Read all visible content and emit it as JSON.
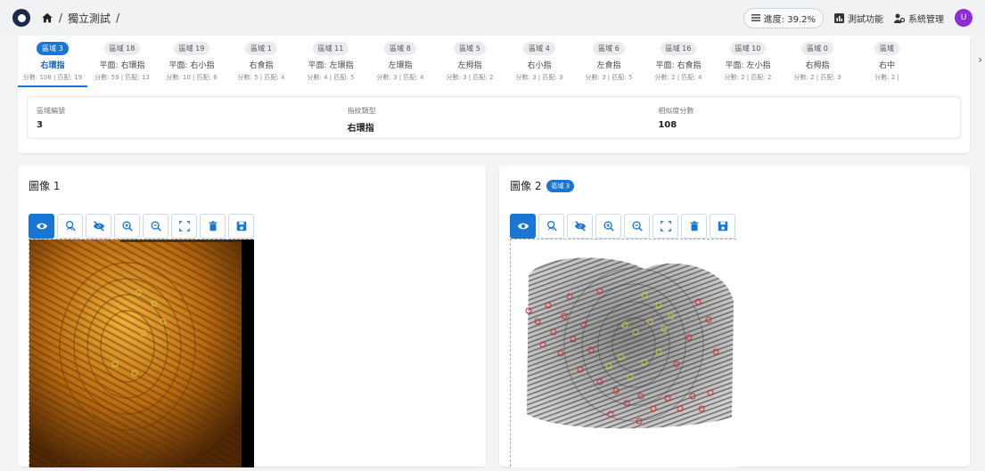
{
  "breadcrumb": {
    "sep1": "/",
    "page": "獨立測試",
    "sep2": "/"
  },
  "header": {
    "progress_label": "進度: 39.2%",
    "test_functions": "測試功能",
    "system_admin": "系統管理",
    "avatar_initial": "U"
  },
  "regions": [
    {
      "chip": "區域 3",
      "name": "右環指",
      "score": "分數: 108 | 匹配: 19",
      "active": true
    },
    {
      "chip": "區域 18",
      "name": "平面: 右環指",
      "score": "分數: 59 | 匹配: 13"
    },
    {
      "chip": "區域 19",
      "name": "平面: 右小指",
      "score": "分數: 10 | 匹配: 6"
    },
    {
      "chip": "區域 1",
      "name": "右食指",
      "score": "分數: 5 | 匹配: 4"
    },
    {
      "chip": "區域 11",
      "name": "平面: 左環指",
      "score": "分數: 4 | 匹配: 5"
    },
    {
      "chip": "區域 8",
      "name": "左環指",
      "score": "分數: 3 | 匹配: 4"
    },
    {
      "chip": "區域 5",
      "name": "左拇指",
      "score": "分數: 3 | 匹配: 2"
    },
    {
      "chip": "區域 4",
      "name": "右小指",
      "score": "分數: 3 | 匹配: 3"
    },
    {
      "chip": "區域 6",
      "name": "左食指",
      "score": "分數: 3 | 匹配: 5"
    },
    {
      "chip": "區域 16",
      "name": "平面: 右食指",
      "score": "分數: 2 | 匹配: 4"
    },
    {
      "chip": "區域 10",
      "name": "平面: 左小指",
      "score": "分數: 2 | 匹配: 2"
    },
    {
      "chip": "區域 0",
      "name": "右拇指",
      "score": "分數: 2 | 匹配: 3"
    },
    {
      "chip": "區域",
      "name": "右中",
      "score": "分數: 2 |"
    }
  ],
  "scroll_right_glyph": "›",
  "details": [
    {
      "label": "區域編號",
      "value": "3"
    },
    {
      "label": "指紋類型",
      "value": "右環指"
    },
    {
      "label": "相似度分數",
      "value": "108"
    }
  ],
  "panel1": {
    "title": "圖像 1"
  },
  "panel2": {
    "title": "圖像 2",
    "badge": "區域 3"
  },
  "toolbar_icons": [
    "eye-icon",
    "search-person-icon",
    "eye-off-icon",
    "zoom-in-icon",
    "zoom-out-icon",
    "fit-screen-icon",
    "delete-icon",
    "save-icon"
  ],
  "colors": {
    "accent": "#1976d2",
    "avatar": "#8e2bd6",
    "minutia_red": "#d42a2a",
    "minutia_yellow": "#c8c830"
  }
}
